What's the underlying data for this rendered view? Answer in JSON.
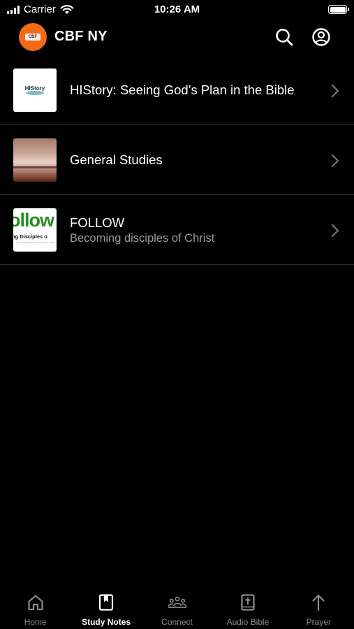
{
  "status_bar": {
    "carrier": "Carrier",
    "time": "10:26 AM"
  },
  "header": {
    "title": "CBF NY",
    "brand_color": "#f26a16",
    "logo_text": "CBF"
  },
  "items": [
    {
      "title": "HIStory: Seeing God’s Plan in the Bible",
      "subtitle": "",
      "thumb_text": "HIStory",
      "thumb_icon": "history-thumbnail"
    },
    {
      "title": "General Studies",
      "subtitle": "",
      "thumb_text": "",
      "thumb_icon": "open-bible-thumbnail"
    },
    {
      "title": "FOLLOW",
      "subtitle": "Becoming disciples of Christ",
      "thumb_text": "ollow",
      "thumb_text_small": "ng Disciples o",
      "thumb_icon": "follow-thumbnail"
    }
  ],
  "tabs": [
    {
      "label": "Home",
      "icon": "home-icon",
      "active": false
    },
    {
      "label": "Study Notes",
      "icon": "bookmark-icon",
      "active": true
    },
    {
      "label": "Connect",
      "icon": "group-icon",
      "active": false
    },
    {
      "label": "Audio Bible",
      "icon": "bible-icon",
      "active": false
    },
    {
      "label": "Prayer",
      "icon": "arrow-up-icon",
      "active": false
    }
  ],
  "colors": {
    "background": "#000000",
    "text_primary": "#ffffff",
    "text_secondary": "#9a9a9a",
    "tab_inactive": "#8a8a8a"
  }
}
